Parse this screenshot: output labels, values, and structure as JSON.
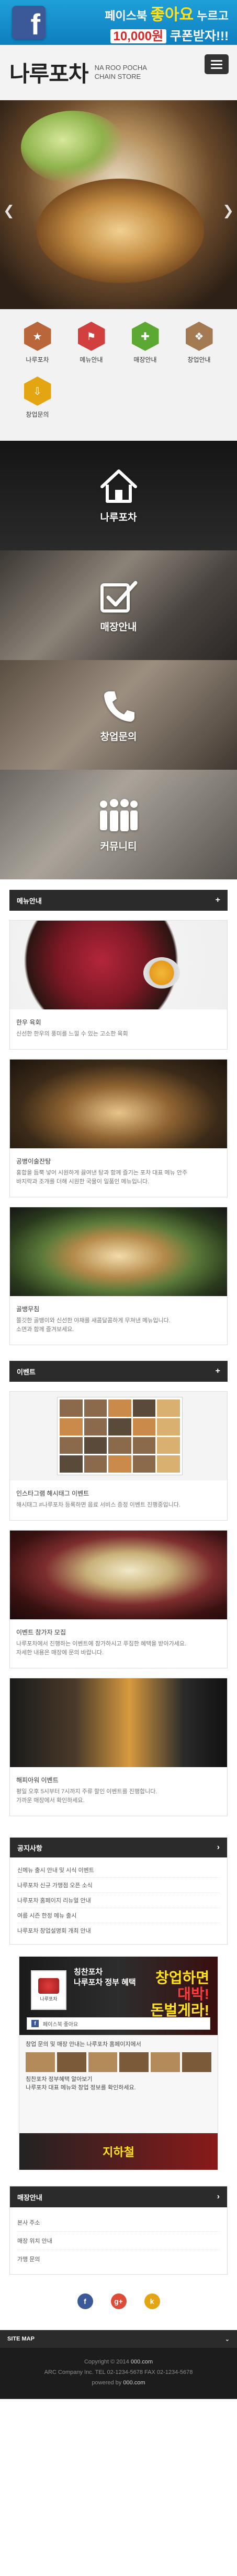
{
  "colors": {
    "header_bg": "#f3f3f3",
    "dark_bar": "#2b2b2b",
    "facebook_blue": "#3b5998",
    "banner_blue": "#1f9fd8",
    "highlight_yellow": "#ffe21b"
  },
  "banner": {
    "line1_prefix": "페이스북 ",
    "line1_highlight": "좋아요",
    "line1_suffix": " 누르고",
    "line2_amount": "10,000원",
    "line2_suffix": " 쿠폰받자!!!"
  },
  "header": {
    "title": "나루포차",
    "subtitle_line1": "NA ROO POCHA",
    "subtitle_line2": "CHAIN STORE"
  },
  "quick_nav": [
    {
      "label": "나루포차",
      "icon": "star-icon",
      "color": "#b9663a"
    },
    {
      "label": "메뉴안내",
      "icon": "flag-icon",
      "color": "#d23f3f"
    },
    {
      "label": "매장안내",
      "icon": "plus-icon",
      "color": "#5ba832"
    },
    {
      "label": "창업안내",
      "icon": "bookmark-icon",
      "color": "#a37a52"
    },
    {
      "label": "창업문의",
      "icon": "download-icon",
      "color": "#e3a612"
    }
  ],
  "panels": [
    {
      "label": "나루포차",
      "icon": "home-icon"
    },
    {
      "label": "매장안내",
      "icon": "checkbox-icon"
    },
    {
      "label": "창업문의",
      "icon": "phone-icon"
    },
    {
      "label": "커뮤니티",
      "icon": "community-icon"
    }
  ],
  "menu_section": {
    "title": "메뉴안내",
    "items": [
      {
        "title": "한우 육회",
        "desc": "신선한 한우의 풍미를 느낄 수 있는 고소한 육회"
      },
      {
        "title": "공병이술잔탕",
        "desc": "홍합을 듬뿍 넣어 시원하게 끓여낸 탕과 함께 즐기는 포차 대표 메뉴 안주",
        "desc2": "바지락과 조개를 더해 시원한 국물이 일품인 메뉴입니다."
      },
      {
        "title": "골뱅무침",
        "desc": "쫄깃한 골뱅이와 신선한 야채를 새콤달콤하게 무쳐낸 메뉴입니다.",
        "desc2": "소면과 함께 즐겨보세요."
      }
    ]
  },
  "event_section": {
    "title": "이벤트",
    "items": [
      {
        "title": "인스타그램 해시태그 이벤트",
        "desc": "해시태그 #나루포차 등록하면 음료 서비스 증정 이벤트 진행중입니다."
      },
      {
        "title": "이벤트 참가자 모집",
        "desc": "나루포차에서 진행하는 이벤트에 참가하시고 푸짐한 혜택을 받아가세요.",
        "desc2": "자세한 내용은 매장에 문의 바랍니다."
      },
      {
        "title": "해피아워 이벤트",
        "desc": "평일 오후 5시부터 7시까지 주류 할인 이벤트를 진행합니다.",
        "desc2": "가까운 매장에서 확인하세요."
      }
    ]
  },
  "notice_section": {
    "title": "공지사항",
    "items": [
      "신메뉴 출시 안내 및 시식 이벤트",
      "나루포차 신규 가맹점 오픈 소식",
      "나루포차 홈페이지 리뉴얼 안내",
      "여름 시즌 한정 메뉴 출시",
      "나루포차 창업설명회 개최 안내"
    ]
  },
  "promo": {
    "badge": "나루포차",
    "title_line1": "칭찬포차",
    "title_line2": "나루포차 정부 혜택",
    "cta_line1": "창업하면",
    "cta_line2": "대박!",
    "cta_line3": "돈벌게라!",
    "bar_text": "페이스북 좋아요",
    "body_line1": "창업 문의 및 매장 안내는 나루포차 홈페이지에서",
    "body_line2": "칭찬포차 정부혜택 알아보기",
    "body_line3": "나루포차 대표 메뉴와 창업 정보를 확인하세요.",
    "footer_text": "지하철"
  },
  "contact_section": {
    "title": "매장안내",
    "items": [
      "본사 주소",
      "매장 위치 안내",
      "가맹 문의"
    ]
  },
  "social": [
    {
      "icon": "facebook-icon",
      "letter": "f",
      "color": "#3b5998"
    },
    {
      "icon": "google-plus-icon",
      "letter": "g+",
      "color": "#dd4b39"
    },
    {
      "icon": "kakao-icon",
      "letter": "k",
      "color": "#e3a612"
    }
  ],
  "sitemap": {
    "label": "SITE MAP",
    "icon": "chevron-down-icon"
  },
  "footer": {
    "line1_prefix": "Copyright © 2014 ",
    "line1_site": "000.com",
    "line2": "ARC Company Inc. TEL 02-1234-5678 FAX 02-1234-5678",
    "line3_prefix": "powered by ",
    "line3_site": "000.com"
  }
}
